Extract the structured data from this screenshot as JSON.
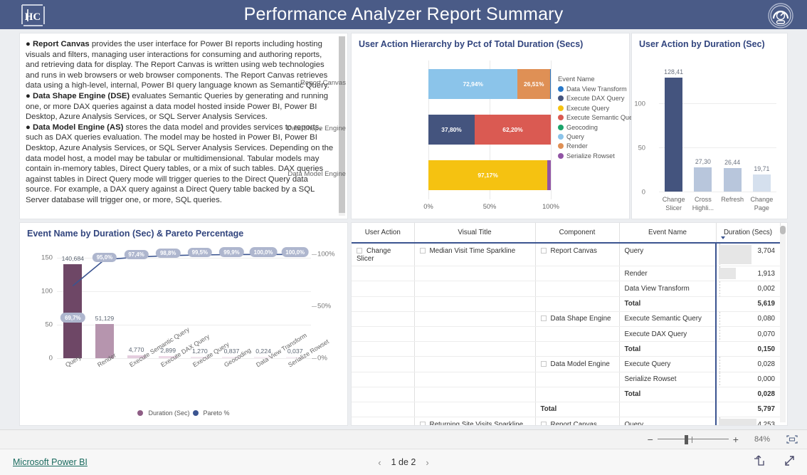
{
  "header": {
    "title": "Performance Analyzer Report Summary",
    "logo_icon": "hc-logo-icon",
    "gauge_icon": "speedometer-icon",
    "bg_color": "#4a5b87"
  },
  "text_panel": {
    "paragraphs": [
      {
        "bullet": "● ",
        "lead": "Report Canvas",
        "body": " provides the user interface for Power BI reports including hosting visuals and filters, managing user interactions for consuming and authoring reports, and retrieving data for display.  The Report Canvas is written using web technologies and runs in web browsers or web browser components.  The Report Canvas retrieves data using a high-level, internal, Power BI query language known as Semantic Query."
      },
      {
        "bullet": "● ",
        "lead": "Data Shape Engine (DSE)",
        "body": " evaluates Semantic Queries by generating and running one, or more DAX queries against a data model hosted inside Power BI, Power BI Desktop, Azure Analysis Services, or SQL Server Analysis Services."
      },
      {
        "bullet": "● ",
        "lead": "Data Model Engine (AS)",
        "body": " stores the data model and provides services to reports, such as DAX queries evaluation.  The model may be hosted in Power BI, Power BI Desktop, Azure Analysis Services, or SQL Server Analysis Services.  Depending on the data model host, a model may be tabular or multidimensional.  Tabular models may contain in-memory tables, Direct Query tables, or a mix of such tables.  DAX queries against tables in Direct Query mode will trigger queries to the Direct Query data source.  For example, a DAX query against a Direct Query table backed by a SQL Server database will trigger one, or more, SQL queries."
      }
    ]
  },
  "chart_data": [
    {
      "id": "stacked",
      "type": "bar",
      "title": "User Action Hierarchy by Pct of Total Duration (Secs)",
      "orientation": "horizontal",
      "stacked": true,
      "xlabel": "",
      "ylabel": "",
      "xlim": [
        0,
        100
      ],
      "xticks": [
        "0%",
        "50%",
        "100%"
      ],
      "grid": true,
      "legend_title": "Event Name",
      "legend_position": "right",
      "legend": [
        {
          "name": "Data View Transform",
          "color": "#2878c8"
        },
        {
          "name": "Execute DAX Query",
          "color": "#44547e"
        },
        {
          "name": "Execute Query",
          "color": "#f5c211"
        },
        {
          "name": "Execute Semantic Query",
          "color": "#da5a52"
        },
        {
          "name": "Geocoding",
          "color": "#1ba46b"
        },
        {
          "name": "Query",
          "color": "#8bc4ea"
        },
        {
          "name": "Render",
          "color": "#df9055"
        },
        {
          "name": "Serialize Rowset",
          "color": "#9154a5"
        }
      ],
      "categories": [
        "Report Canvas",
        "Data Shape Engine",
        "Data Model Engine"
      ],
      "rows": [
        {
          "category": "Report Canvas",
          "segments": [
            {
              "name": "Query",
              "value": 72.94,
              "label": "72,94%",
              "color": "#8bc4ea"
            },
            {
              "name": "Render",
              "value": 26.51,
              "label": "26,51%",
              "color": "#df9055"
            },
            {
              "name": "Data View Transform",
              "value": 0.55,
              "label": "",
              "color": "#2878c8"
            }
          ]
        },
        {
          "category": "Data Shape Engine",
          "segments": [
            {
              "name": "Execute DAX Query",
              "value": 37.8,
              "label": "37,80%",
              "color": "#44547e"
            },
            {
              "name": "Execute Semantic Query",
              "value": 62.2,
              "label": "62,20%",
              "color": "#da5a52"
            }
          ]
        },
        {
          "category": "Data Model Engine",
          "segments": [
            {
              "name": "Execute Query",
              "value": 97.17,
              "label": "97,17%",
              "color": "#f5c211"
            },
            {
              "name": "Serialize Rowset",
              "value": 2.83,
              "label": "",
              "color": "#9154a5"
            }
          ]
        }
      ]
    },
    {
      "id": "column",
      "type": "bar",
      "title": "User Action by Duration (Sec)",
      "orientation": "vertical",
      "xlabel": "",
      "ylabel": "",
      "ylim": [
        0,
        140
      ],
      "yticks": [
        0,
        50,
        100
      ],
      "grid": true,
      "categories": [
        "Change Slicer",
        "Cross Highli...",
        "Refresh",
        "Change Page"
      ],
      "values": [
        128.41,
        27.3,
        26.44,
        19.71
      ],
      "value_labels": [
        "128,41",
        "27,30",
        "26,44",
        "19,71"
      ],
      "colors": [
        "#44547e",
        "#b8c6dc",
        "#b8c6dc",
        "#d5e0ee"
      ]
    },
    {
      "id": "pareto",
      "type": "bar",
      "title": "Event Name by Duration (Sec) & Pareto Percentage",
      "xlabel": "",
      "ylabel": "",
      "ylim": [
        0,
        165
      ],
      "yticks": [
        0,
        50,
        100,
        150
      ],
      "y2lim": [
        0,
        100
      ],
      "y2ticks": [
        "0%",
        "50%",
        "100%"
      ],
      "grid": true,
      "legend_position": "bottom",
      "legend": [
        {
          "name": "Duration (Sec)",
          "color": "#8e5d85"
        },
        {
          "name": "Pareto %",
          "color": "#3b5490"
        }
      ],
      "categories": [
        "Query",
        "Render",
        "Execute Semantic Query",
        "Execute DAX Query",
        "Execute Query",
        "Geocoding",
        "Data View Transform",
        "Serialize Rowset"
      ],
      "series": [
        {
          "name": "Duration (Sec)",
          "values": [
            140.684,
            51.129,
            4.77,
            2.899,
            1.27,
            0.837,
            0.224,
            0.037
          ],
          "value_labels": [
            "140,684",
            "51,129",
            "4,770",
            "2,899",
            "1,270",
            "0,837",
            "0,224",
            "0,037"
          ],
          "colors": [
            "#6e4766",
            "#b695ae",
            "#e4cdde",
            "#edd9e7",
            "#f2e4ee",
            "#f4e9f1",
            "#f6edf3",
            "#f7eff5"
          ]
        },
        {
          "name": "Pareto %",
          "values": [
            69.7,
            95.0,
            97.4,
            98.8,
            99.5,
            99.9,
            100.0,
            100.0
          ],
          "value_labels": [
            "69,7%",
            "95,0%",
            "97,4%",
            "98,8%",
            "99,5%",
            "99,9%",
            "100,0%",
            "100,0%"
          ]
        }
      ]
    }
  ],
  "table": {
    "columns": [
      "User Action",
      "Visual Title",
      "Component",
      "Event Name",
      "Duration (Secs)"
    ],
    "sort_column": "Duration (Secs)",
    "rows": [
      {
        "user_action": "Change Slicer",
        "visual_title": "Median Visit Time Sparkline",
        "component": "Report Canvas",
        "event_name": "Query",
        "duration": "3,704",
        "bold": false,
        "bar_pct": 62
      },
      {
        "user_action": "",
        "visual_title": "",
        "component": "",
        "event_name": "Render",
        "duration": "1,913",
        "bold": false,
        "bar_pct": 32
      },
      {
        "user_action": "",
        "visual_title": "",
        "component": "",
        "event_name": "Data View Transform",
        "duration": "0,002",
        "bold": false,
        "bar_pct": 0
      },
      {
        "user_action": "",
        "visual_title": "",
        "component": "",
        "event_name": "Total",
        "duration": "5,619",
        "bold": true,
        "bar_pct": 0
      },
      {
        "user_action": "",
        "visual_title": "",
        "component": "Data Shape Engine",
        "event_name": "Execute Semantic Query",
        "duration": "0,080",
        "bold": false,
        "bar_pct": 0
      },
      {
        "user_action": "",
        "visual_title": "",
        "component": "",
        "event_name": "Execute DAX Query",
        "duration": "0,070",
        "bold": false,
        "bar_pct": 0
      },
      {
        "user_action": "",
        "visual_title": "",
        "component": "",
        "event_name": "Total",
        "duration": "0,150",
        "bold": true,
        "bar_pct": 0
      },
      {
        "user_action": "",
        "visual_title": "",
        "component": "Data Model Engine",
        "event_name": "Execute Query",
        "duration": "0,028",
        "bold": false,
        "bar_pct": 0
      },
      {
        "user_action": "",
        "visual_title": "",
        "component": "",
        "event_name": "Serialize Rowset",
        "duration": "0,000",
        "bold": false,
        "bar_pct": 0
      },
      {
        "user_action": "",
        "visual_title": "",
        "component": "",
        "event_name": "Total",
        "duration": "0,028",
        "bold": true,
        "bar_pct": 0
      },
      {
        "user_action": "",
        "visual_title": "",
        "component": "Total",
        "event_name": "",
        "duration": "5,797",
        "bold": true,
        "bar_pct": 0
      },
      {
        "user_action": "",
        "visual_title": "Returning Site Visits Sparkline",
        "component": "Report Canvas",
        "event_name": "Query",
        "duration": "4,253",
        "bold": false,
        "bar_pct": 72
      }
    ]
  },
  "statusbar": {
    "zoom_minus": "−",
    "zoom_plus": "+",
    "zoom_percent": "84%",
    "fit_icon": "fit-to-page-icon"
  },
  "footer": {
    "brand": "Microsoft Power BI",
    "prev_icon": "‹",
    "next_icon": "›",
    "page_text": "1 de 2",
    "share_icon": "share-icon",
    "fullscreen_icon": "fullscreen-icon"
  }
}
